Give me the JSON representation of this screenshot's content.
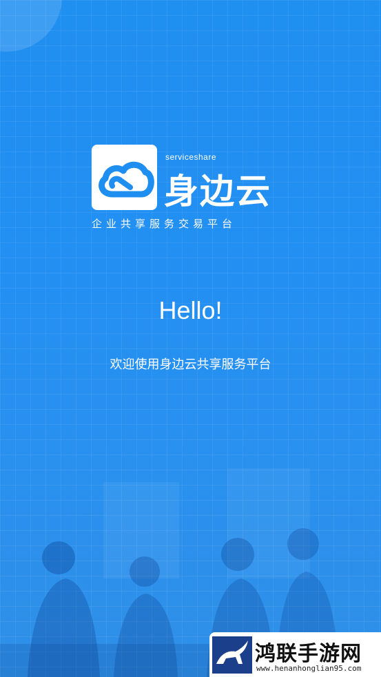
{
  "brand": {
    "subtitle": "serviceshare",
    "name": "身边云",
    "tagline": "企业共享服务交易平台"
  },
  "hero": {
    "greeting": "Hello!",
    "welcome": "欢迎使用身边云共享服务平台"
  },
  "watermark": {
    "name": "鸿联手游网",
    "url": "www.henanhonglian95.com"
  },
  "colors": {
    "background": "#1f8ff0",
    "logo_blue": "#1e8ef0"
  }
}
